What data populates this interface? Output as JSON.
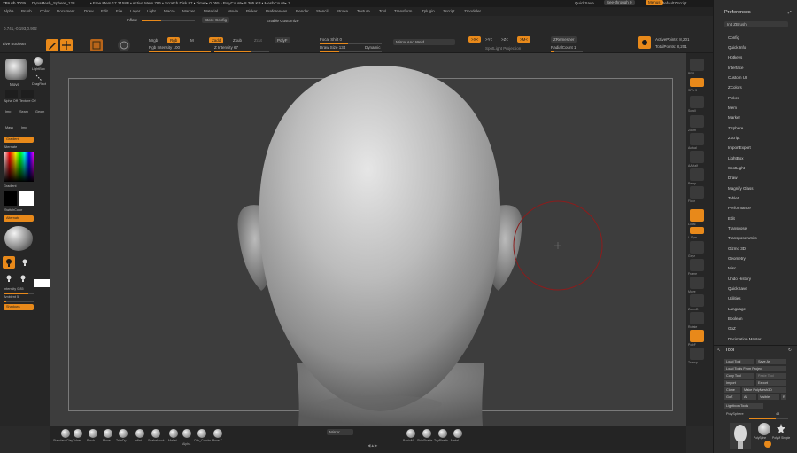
{
  "titlebar": {
    "app": "ZBrush 2019",
    "doc": "DynaMesh_Sphere_128",
    "stats": "• Free Mem 17.2158B • Active Mem 786 • Scratch Disk 87 • Timer▸ 0.055 • PolyCount▸ 8.305 KP • MeshCount▸ 1",
    "quicksave": "QuickSave",
    "seethrough": "See-through 0",
    "menus": "Menus",
    "defaultzscript": "DefaultZScript"
  },
  "menubar": [
    "Alpha",
    "Brush",
    "Color",
    "Document",
    "Draw",
    "Edit",
    "File",
    "Layer",
    "Light",
    "Macro",
    "Marker",
    "Material",
    "Movie",
    "Picker",
    "Preferences",
    "Render",
    "Stencil",
    "Stroke",
    "Texture",
    "Tool",
    "Transform",
    "Zplugin",
    "Zscript",
    "Zmodeler"
  ],
  "menubar_sub": {
    "inflate": "Inflate",
    "store_config": "Store Config",
    "enable_customize": "Enable Customize"
  },
  "shelf": {
    "coords": "0.741,-0.193,0.902",
    "lightbox": "LightBox",
    "live_boolean": "Live Boolean",
    "edit": "Edit",
    "draw": "Draw",
    "mrgb": "Mrgb",
    "rgb": "Rgb",
    "m": "M",
    "zadd": "Zadd",
    "zsub": "Zsub",
    "zcut": "Zcut",
    "polyf": "PolyF",
    "rgb_intensity": "Rgb Intensity 100",
    "z_intensity": "Z Intensity 67",
    "focal_shift": "Focal Shift 0",
    "draw_size": "Draw Size 134",
    "dynamic": "Dynamic",
    "mirror_weld": "Mirror And Weld",
    "activepoints": "ActivePoints: 8,201",
    "totalpoints": "TotalPoints: 8,201",
    "symmetry_x": ">X<",
    "symmetry_y": ">Y<",
    "symmetry_z": ">Z<",
    "symmetry_m": ">M<",
    "zremesher": "ZRemesher",
    "spotlight": "SpotLight",
    "projection": "SpotLight Projection",
    "radial": "RadialCount 1"
  },
  "left": {
    "brush_name": "Move",
    "stroke_name": "DragRect",
    "alpha_name": "Alpha Off",
    "texture_name": "Texture Off",
    "gradient": "Gradient",
    "switch_color": "SwitchColor",
    "alternate": "Alternate",
    "mask": "Mask",
    "imp": "Imp",
    "seam": "Seam",
    "geom": "Geom",
    "ambient": "Ambient",
    "intensity": "Intensity 0.85",
    "lightbox_label": "LightBox",
    "shadows": "Shadows",
    "ambient_value": "Ambient 5"
  },
  "canvas": {
    "bg": "#3d3d3d",
    "brush_cursor_color": "#8a1d1d"
  },
  "right_icons": [
    "BPR",
    "SPix 3",
    "Scroll",
    "Zoom",
    "Actual",
    "AAHalf",
    "Persp",
    "Floor",
    "Local",
    "L.Sym",
    "Gxyz",
    "Frame",
    "Move",
    "ZoomD",
    "Rotate",
    "PolyF",
    "Transp",
    "Dynamic",
    "Solo"
  ],
  "bottom": {
    "brushes": [
      "Standard",
      "ClayTubes",
      "Pinch",
      "Move",
      "TrimDy",
      "Inflat",
      "SnakeHook",
      "Mallet",
      "Alpha",
      "Orb_Cracks",
      "Move T"
    ],
    "center_label": "Mirror",
    "right_brushes": [
      "BasicM",
      "SkinShade",
      "ToyPlastic",
      "Metal I"
    ]
  },
  "prefs": {
    "title": "Preferences",
    "init": "Init ZBrush",
    "items": [
      "Config",
      "Quick Info",
      "Hotkeys",
      "Interface",
      "Custom UI",
      "ZColors",
      "Picker",
      "Mem",
      "Marker",
      "ZSphere",
      "Zscript",
      "ImportExport",
      "LightBox",
      "SpotLight",
      "Draw",
      "Magnify Glass",
      "Tablet",
      "Performance",
      "Edit",
      "Transpose",
      "Transpose Units",
      "Gizmo 3D",
      "Geometry",
      "Misc",
      "Undo History",
      "QuickSave",
      "Utilities",
      "Language",
      "Boolean",
      "GoZ",
      "Decimation Master"
    ]
  },
  "tool_panel": {
    "title": "Tool",
    "load_tool": "Load Tool",
    "save_as": "Save As",
    "load_from_project": "Load Tools From Project",
    "copy_tool": "Copy Tool",
    "paste_tool": "Paste Tool",
    "import": "Import",
    "export": "Export",
    "clone": "Clone",
    "make_polymesh": "Make PolyMesh3D",
    "goz": "GoZ",
    "all": "All",
    "visible": "Visible",
    "r": "R",
    "lightbox_tools": "Lightbox▸Tools",
    "polysphere": "PolySphere",
    "polycount": "48",
    "thumb_labels": [
      "PolySphe",
      "PolyM Simple"
    ]
  }
}
